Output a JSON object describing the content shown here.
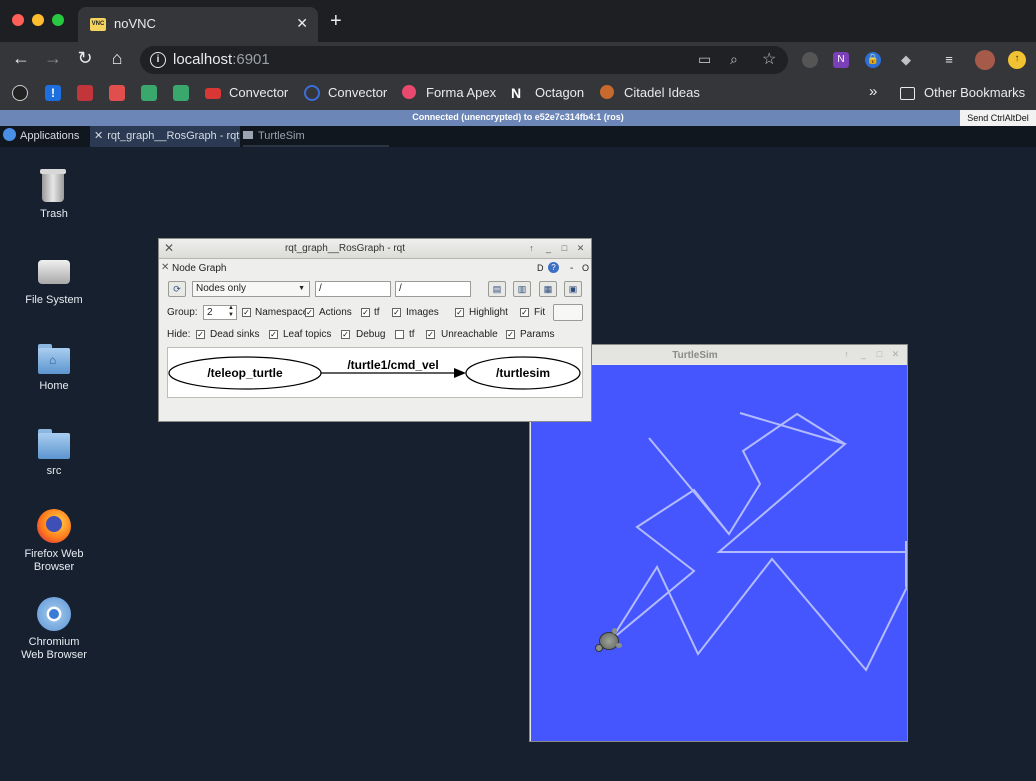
{
  "browser": {
    "tab_title": "noVNC",
    "tab_favicon_text": "VNC",
    "url_host": "localhost",
    "url_port": ":6901",
    "bookmarks": [
      "Convector",
      "Convector",
      "Forma Apex",
      "Octagon",
      "Citadel Ideas"
    ],
    "more_label": "»",
    "other_bookmarks": "Other Bookmarks"
  },
  "novnc": {
    "status": "Connected (unencrypted) to e52e7c314fb4:1 (ros)",
    "send_cad": "Send CtrlAltDel"
  },
  "panel": {
    "applications": "Applications",
    "task_rqt": "rqt_graph__RosGraph - rqt",
    "task_turtlesim": "TurtleSim"
  },
  "desktop": {
    "trash": "Trash",
    "filesystem": "File System",
    "home": "Home",
    "src": "src",
    "firefox_line1": "Firefox Web",
    "firefox_line2": "Browser",
    "chromium_line1": "Chromium",
    "chromium_line2": "Web Browser"
  },
  "rqt": {
    "title": "rqt_graph__RosGraph - rqt",
    "plugin_title": "Node Graph",
    "plugin_controls": "D",
    "plugin_dash": "-",
    "plugin_o": "O",
    "mode_select": "Nodes only",
    "filter1": "/",
    "filter2": "/",
    "group_label": "Group:",
    "group_value": "2",
    "namespaces": "Namespaces",
    "actions": "Actions",
    "tf": "tf",
    "images": "Images",
    "highlight": "Highlight",
    "fit": "Fit",
    "hide_label": "Hide:",
    "dead_sinks": "Dead sinks",
    "leaf_topics": "Leaf topics",
    "debug": "Debug",
    "tf_hide": "tf",
    "unreachable": "Unreachable",
    "params": "Params",
    "node_teleop": "/teleop_turtle",
    "topic": "/turtle1/cmd_vel",
    "node_turtlesim": "/turtlesim"
  },
  "turtlesim": {
    "title": "TurtleSim",
    "background_color": "#4556ff",
    "path_color": "#b3bbff"
  }
}
